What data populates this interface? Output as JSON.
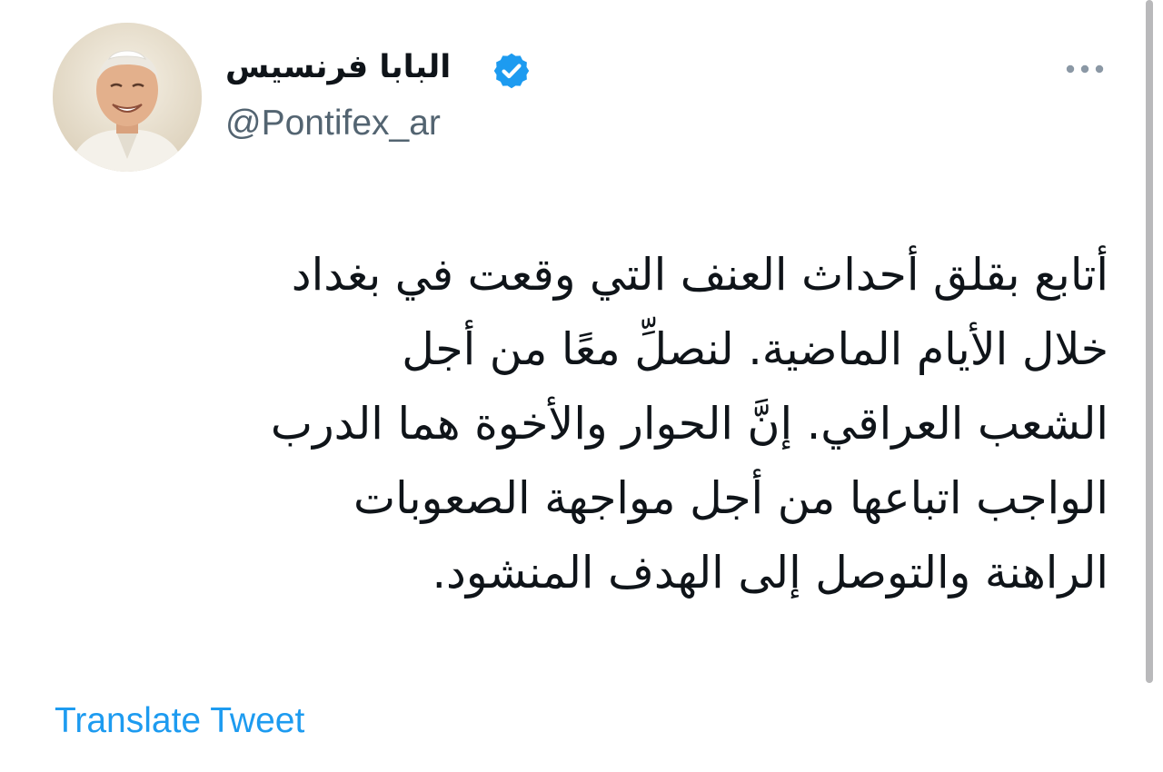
{
  "tweet": {
    "author": {
      "display_name": "البابا فرنسيس",
      "handle": "@Pontifex_ar",
      "verified": true,
      "avatar_icon": "avatar-photo"
    },
    "more_icon": "more-horizontal-icon",
    "text_lines": [
      "أتابع بقلق أحداث العنف التي وقعت في بغداد",
      "خلال الأيام الماضية. لنصلِّ معًا من أجل",
      "الشعب العراقي. إنَّ الحوار والأخوة هما الدرب",
      "الواجب اتباعها من أجل مواجهة الصعوبات",
      "الراهنة والتوصل إلى الهدف المنشود."
    ],
    "translate_label": "Translate Tweet"
  },
  "colors": {
    "text": "#0f1419",
    "secondary": "#536471",
    "accent": "#1d9bf0",
    "more_dots": "#8b98a5"
  }
}
